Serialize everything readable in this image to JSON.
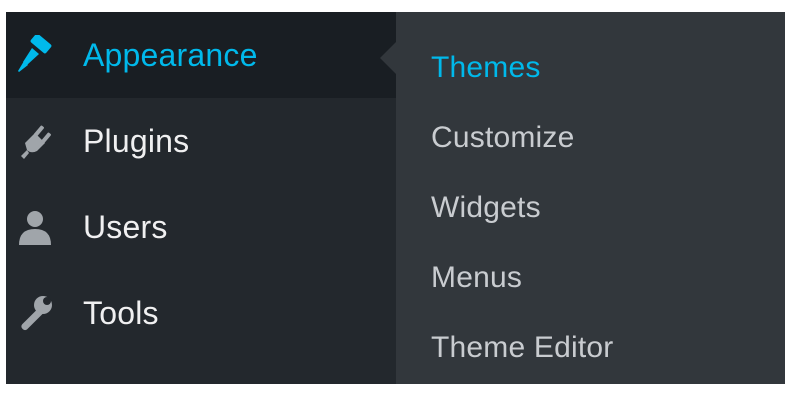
{
  "colors": {
    "sidebar_bg": "#23282d",
    "active_bg": "#191e23",
    "submenu_bg": "#32373c",
    "accent": "#00b9eb",
    "text": "#f0f0f1",
    "submenu_text": "#c9ccd0"
  },
  "sidebar": {
    "items": [
      {
        "label": "Appearance",
        "icon": "paintbrush-icon",
        "active": true
      },
      {
        "label": "Plugins",
        "icon": "plug-icon",
        "active": false
      },
      {
        "label": "Users",
        "icon": "user-icon",
        "active": false
      },
      {
        "label": "Tools",
        "icon": "wrench-icon",
        "active": false
      }
    ]
  },
  "submenu": {
    "items": [
      {
        "label": "Themes",
        "active": true
      },
      {
        "label": "Customize",
        "active": false
      },
      {
        "label": "Widgets",
        "active": false
      },
      {
        "label": "Menus",
        "active": false
      },
      {
        "label": "Theme Editor",
        "active": false
      }
    ]
  }
}
